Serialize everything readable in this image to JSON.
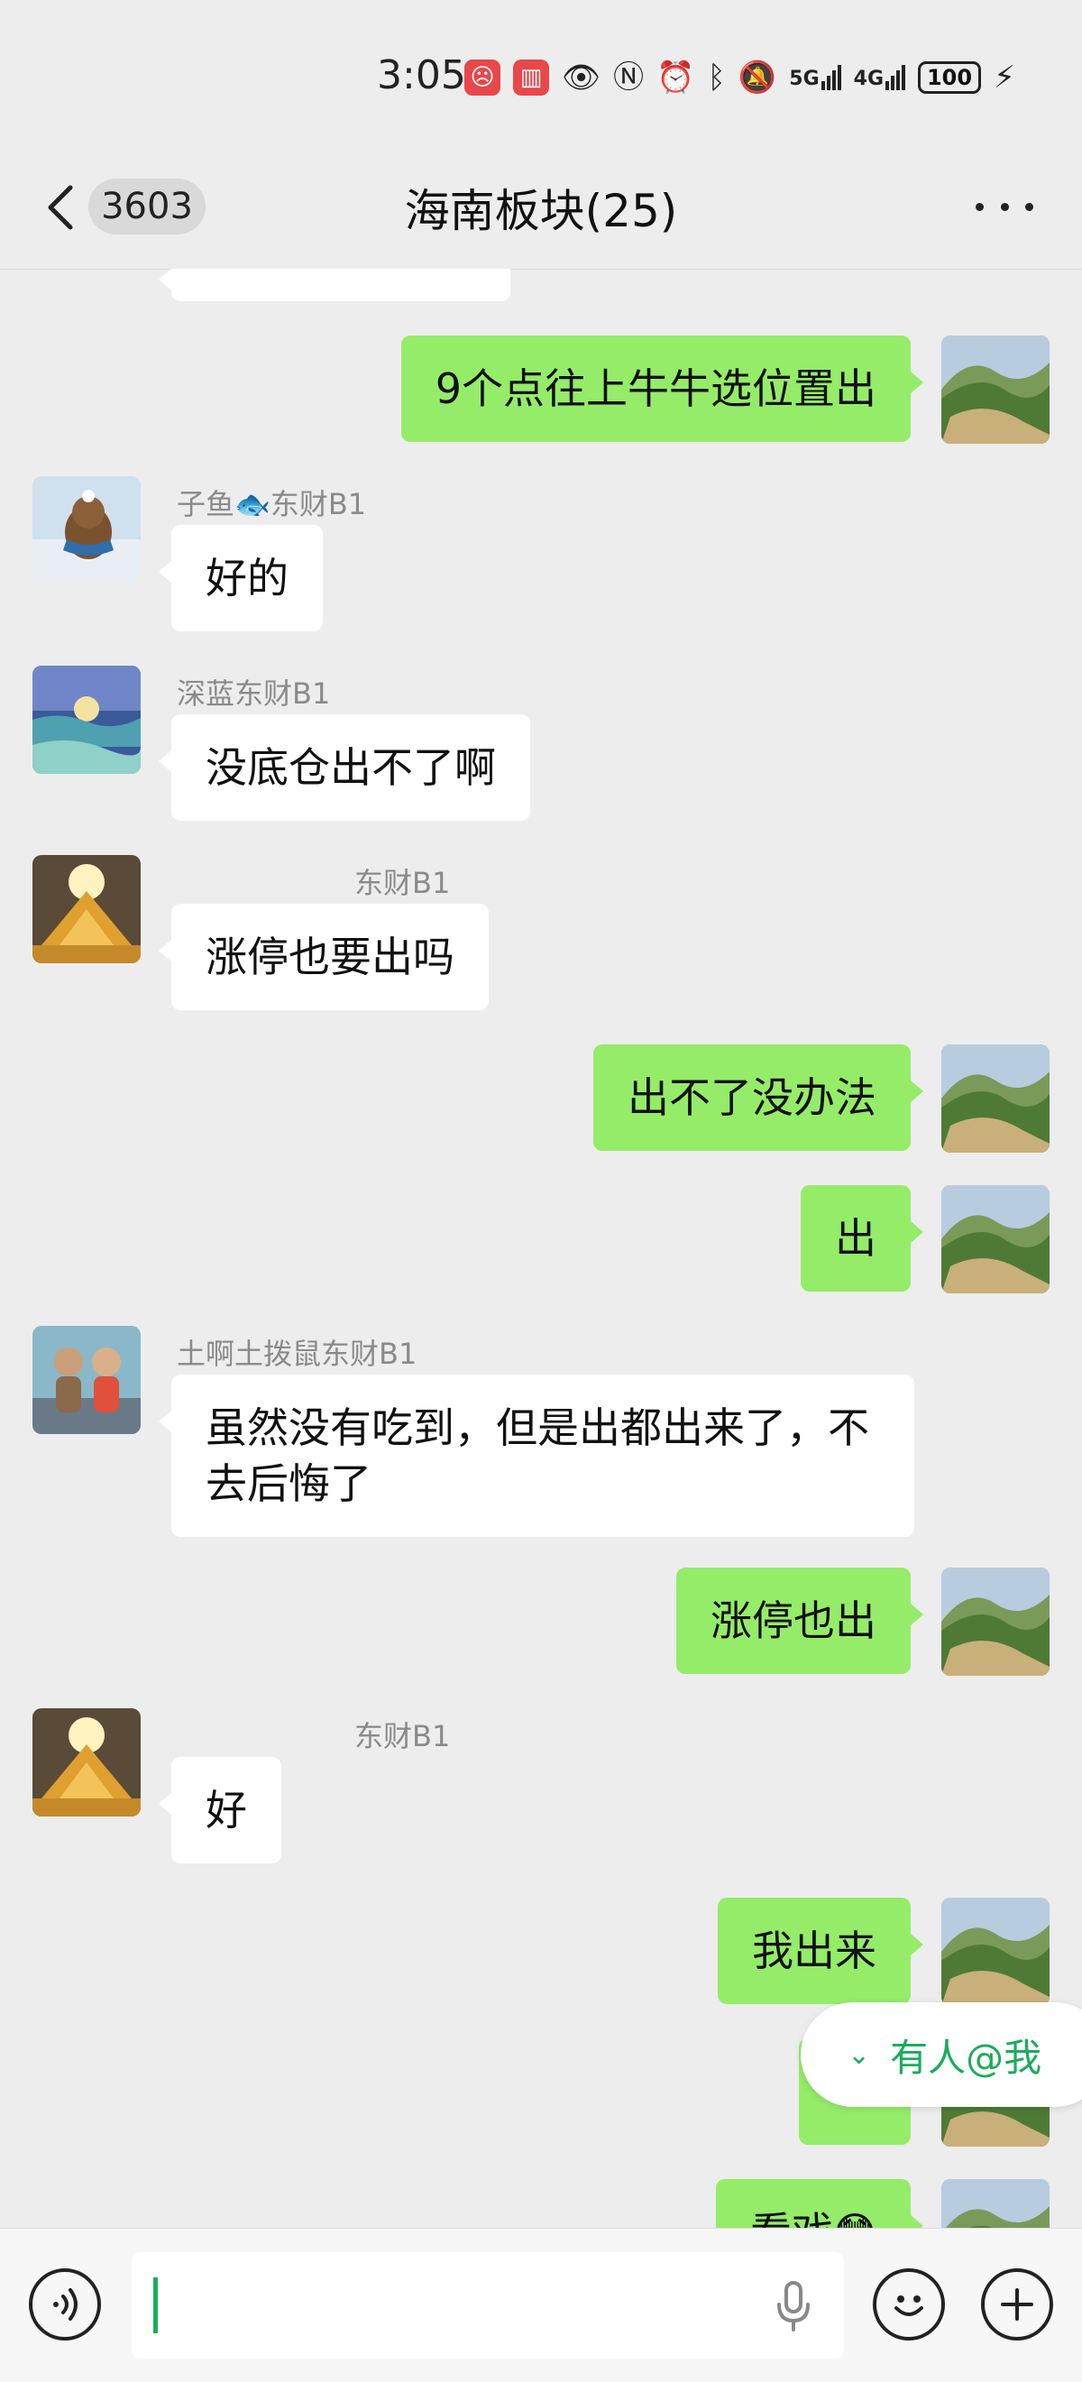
{
  "status_bar": {
    "time": "3:05",
    "battery": "100",
    "network_5g": "5G",
    "network_4g": "4G"
  },
  "header": {
    "unread_count": "3603",
    "title": "海南板块(25)"
  },
  "messages": [
    {
      "type": "out",
      "text": "9个点往上牛牛选位置出"
    },
    {
      "type": "in",
      "sender": "子鱼🐟东财B1",
      "text": "好的"
    },
    {
      "type": "in",
      "sender": "深蓝东财B1",
      "text": "没底仓出不了啊"
    },
    {
      "type": "in",
      "sender": "东财B1",
      "text": "涨停也要出吗"
    },
    {
      "type": "out",
      "text": "出不了没办法"
    },
    {
      "type": "out",
      "text": "出"
    },
    {
      "type": "in",
      "sender": "土啊土拨鼠东财B1",
      "text": "虽然没有吃到，但是出都出来了，不去后悔了"
    },
    {
      "type": "out",
      "text": "涨停也出"
    },
    {
      "type": "in",
      "sender": "东财B1",
      "text": "好"
    },
    {
      "type": "out",
      "text": "我出来"
    },
    {
      "type": "out",
      "text": ""
    },
    {
      "type": "out",
      "text": "看戏😳"
    }
  ],
  "mention_notice": {
    "label": "有人@我",
    "icon": "double-chevron-down-icon"
  },
  "input_bar": {
    "voice_icon": "voice-wave-icon",
    "mic_icon": "microphone-icon",
    "emoji_icon": "smiley-icon",
    "plus_icon": "plus-icon"
  },
  "colors": {
    "bubble_out": "#95ec69",
    "bubble_in": "#ffffff",
    "background": "#ededed",
    "accent": "#1aad5b"
  }
}
